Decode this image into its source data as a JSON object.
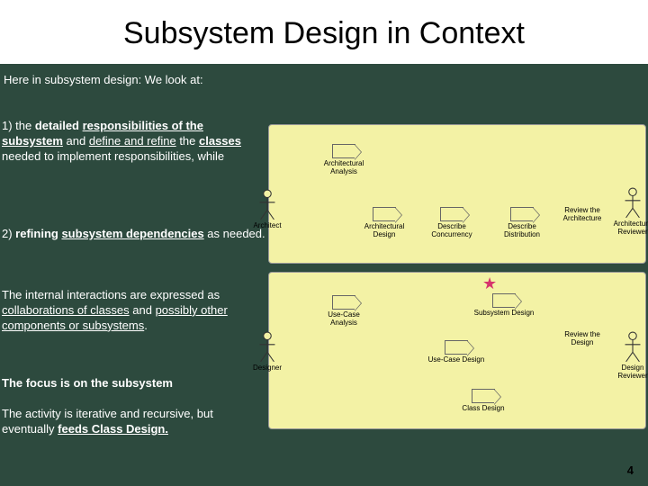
{
  "title": "Subsystem Design in Context",
  "intro": "Here in subsystem design:  We look at:",
  "left": {
    "p1a": "1) the ",
    "p1b": "detailed ",
    "p1c": "responsibilities of the subsystem",
    "p1d": " and ",
    "p1e": "define and refine",
    "p1f": " the ",
    "p1g": "classes",
    "p1h": " needed to implement responsibilities, while",
    "p2a": "2) ",
    "p2b": "refining ",
    "p2c": "subsystem dependencies",
    "p2d": " as needed.",
    "p3a": "The internal interactions are expressed as ",
    "p3b": "collaborations of classes",
    "p3c": " and ",
    "p3d": "possibly other components or subsystems",
    "p3e": ".",
    "p4": "The focus is on the subsystem",
    "p5a": "The activity is iterative and recursive, but eventually ",
    "p5b": "feeds Class Design."
  },
  "actors": {
    "architect": "Architect",
    "arch_reviewer": "Architecture Reviewer",
    "designer": "Designer",
    "design_reviewer": "Design Reviewer"
  },
  "activities": {
    "arch_analysis": "Architectural Analysis",
    "arch_design": "Architectural Design",
    "desc_conc": "Describe Concurrency",
    "desc_dist": "Describe Distribution",
    "review_arch": "Review the Architecture",
    "uc_analysis": "Use-Case Analysis",
    "subsys_design": "Subsystem Design",
    "uc_design": "Use-Case Design",
    "class_design": "Class Design",
    "review_design": "Review the Design"
  },
  "page_number": "4"
}
